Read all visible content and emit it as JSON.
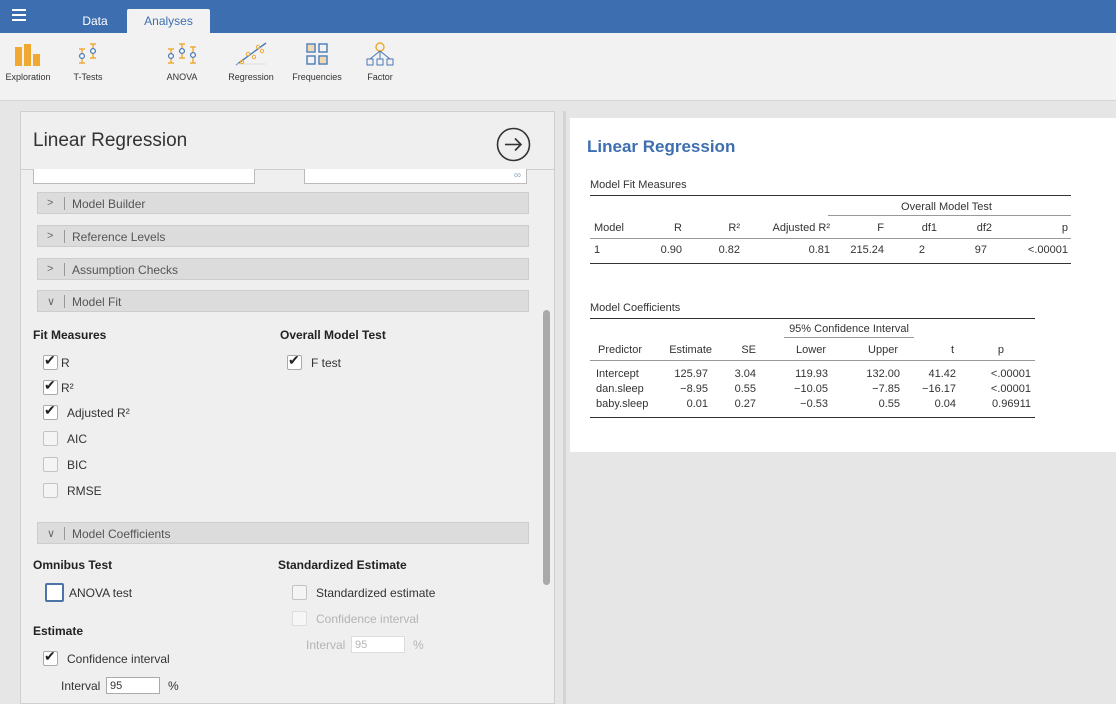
{
  "topbar": {
    "menu_icon": "hamburger-icon",
    "tabs": [
      {
        "label": "Data"
      },
      {
        "label": "Analyses"
      }
    ]
  },
  "ribbon": {
    "items": [
      {
        "label": "Exploration",
        "icon": "exploration-icon"
      },
      {
        "label": "T-Tests",
        "icon": "t-tests-icon"
      },
      {
        "label": "ANOVA",
        "icon": "anova-icon"
      },
      {
        "label": "Regression",
        "icon": "regression-icon"
      },
      {
        "label": "Frequencies",
        "icon": "frequencies-icon"
      },
      {
        "label": "Factor",
        "icon": "factor-icon"
      }
    ]
  },
  "options": {
    "title": "Linear Regression",
    "go_icon": "arrow-right-circle-icon",
    "sections": {
      "model_builder": "Model Builder",
      "reference_levels": "Reference Levels",
      "assumption_checks": "Assumption Checks",
      "model_fit": "Model Fit",
      "model_coefficients": "Model Coefficients"
    },
    "fit_measures": {
      "heading": "Fit Measures",
      "items": [
        {
          "label": "R",
          "checked": true
        },
        {
          "label": "R²",
          "checked": true
        },
        {
          "label": "Adjusted R²",
          "checked": true
        },
        {
          "label": "AIC",
          "checked": false
        },
        {
          "label": "BIC",
          "checked": false
        },
        {
          "label": "RMSE",
          "checked": false
        }
      ]
    },
    "overall_model_test": {
      "heading": "Overall Model Test",
      "ftest": {
        "label": "F test",
        "checked": true
      }
    },
    "omnibus": {
      "heading": "Omnibus Test",
      "anova": {
        "label": "ANOVA test",
        "checked": false
      }
    },
    "standardized": {
      "heading": "Standardized Estimate",
      "estimate": {
        "label": "Standardized estimate",
        "checked": false
      },
      "ci": {
        "label": "Confidence interval",
        "checked": false
      },
      "interval_label": "Interval",
      "interval_value": "95",
      "interval_unit": "%"
    },
    "estimate": {
      "heading": "Estimate",
      "ci": {
        "label": "Confidence interval",
        "checked": true
      },
      "interval_label": "Interval",
      "interval_value": "95",
      "interval_unit": "%"
    }
  },
  "results": {
    "title": "Linear Regression",
    "fit": {
      "title": "Model Fit Measures",
      "span_header": "Overall Model Test",
      "headers": [
        "Model",
        "R",
        "R²",
        "Adjusted R²",
        "F",
        "df1",
        "df2",
        "p"
      ],
      "rows": [
        [
          "1",
          "0.90",
          "0.82",
          "0.81",
          "215.24",
          "2",
          "97",
          "<.00001"
        ]
      ]
    },
    "coef": {
      "title": "Model Coefficients",
      "span_header": "95% Confidence Interval",
      "headers": [
        "Predictor",
        "Estimate",
        "SE",
        "Lower",
        "Upper",
        "t",
        "p"
      ],
      "rows": [
        [
          "Intercept",
          "125.97",
          "3.04",
          "119.93",
          "132.00",
          "41.42",
          "<.00001"
        ],
        [
          "dan.sleep",
          "−8.95",
          "0.55",
          "−10.05",
          "−7.85",
          "−16.17",
          "<.00001"
        ],
        [
          "baby.sleep",
          "0.01",
          "0.27",
          "−0.53",
          "0.55",
          "0.04",
          "0.96911"
        ]
      ]
    }
  }
}
